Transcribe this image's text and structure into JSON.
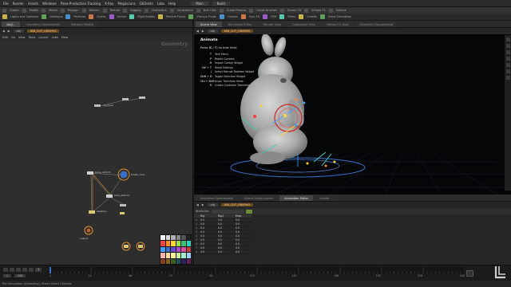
{
  "menubar": {
    "items": [
      "File",
      "Render",
      "Assets",
      "Windows",
      "Pane Production Tracking",
      "X-Ray",
      "Megascans",
      "GEOsets",
      "Labs",
      "Help"
    ],
    "title": "Main",
    "mode": "Build"
  },
  "shelf": {
    "tabs": [
      "Create",
      "Modify",
      "Model",
      "Polygon",
      "Deform",
      "Texture",
      "Rigging",
      "Characters",
      "Constraints",
      "Hair Utils",
      "Guide Process",
      "Guide Brushes",
      "Terrain FX",
      "Simple FX",
      "Volume"
    ]
  },
  "toolbar": {
    "items": [
      "Lights and Cameras",
      "Collisions",
      "Particles",
      "Grains",
      "Vellum",
      "Rigid Bodies",
      "Particle Fluids",
      "Viscous Fluids",
      "Oceans",
      "Pyro FX",
      "FEM",
      "Wires",
      "Crowds",
      "Drive Simulation"
    ]
  },
  "network": {
    "tabs": [
      "/obj/...",
      "Geometry Spreadsheet",
      "Material Palette"
    ],
    "path": "obj",
    "node_path": "KIN_CUT_GRAPHO",
    "menu": [
      "Edit",
      "Go",
      "View",
      "Tools",
      "Layout",
      "Labs",
      "Help"
    ],
    "context_label": "Geometry",
    "nodes": [
      "rig_pose",
      "bone_deform",
      "joint_deform",
      "kinefx_char",
      "skeleton",
      "output"
    ]
  },
  "viewport": {
    "tabs": [
      "Scene View",
      "Animation Editor",
      "Render View",
      "Composite View",
      "Motion FX View",
      "Geometry Spreadsheet"
    ],
    "path": "obj",
    "node_path": "KIN_CUT_GRAPHO",
    "state_title": "Animate",
    "hint": "Press ⌘ / F1 to hide hints",
    "keys": [
      {
        "k": "T",
        "label": "Task Menu"
      },
      {
        "k": "P",
        "label": "Rotate Controls"
      },
      {
        "k": "H",
        "label": "Import Control Widget"
      },
      {
        "k": "Ctrl + T",
        "label": "Reset Settings"
      },
      {
        "k": "J",
        "label": "Select Manual Skeleton Widget"
      },
      {
        "k": "Shift + D",
        "label": "Toggle Selection Widget"
      },
      {
        "k": "Ctrl + Shift",
        "label": "Unpin Transform Mode"
      },
      {
        "k": "R",
        "label": "Create Controller Transform"
      }
    ]
  },
  "spreadsheet": {
    "tabs": [
      "Keyframe Spreadsheet",
      "Scene Graph Layers",
      "Animation Editor",
      "Ladder"
    ],
    "path": "obj",
    "node_path": "KIN_CUT_GRAPHO",
    "columns": [
      "",
      "Rig",
      "Rig2",
      "Pose"
    ],
    "rows": [
      [
        "0",
        "0.0",
        "0.0",
        "0.0"
      ],
      [
        "1",
        "0.0",
        "0.0",
        "0.0"
      ],
      [
        "2",
        "0.0",
        "0.0",
        "0.0"
      ],
      [
        "3",
        "0.0",
        "0.0",
        "0.0"
      ],
      [
        "4",
        "0.0",
        "0.0",
        "0.0"
      ],
      [
        "5",
        "0.0",
        "0.0",
        "0.0"
      ],
      [
        "6",
        "0.0",
        "0.0",
        "0.0"
      ],
      [
        "7",
        "0.0",
        "0.0",
        "0.0"
      ],
      [
        "8",
        "0.0",
        "0.0",
        "0.0"
      ]
    ],
    "filter_label": "Attributes"
  },
  "timeline": {
    "frame": "1",
    "start": "1",
    "end": "240",
    "fps": "24",
    "ticks": [
      "1",
      "24",
      "48",
      "72",
      "96",
      "120",
      "144",
      "168",
      "192",
      "216",
      "240"
    ]
  },
  "status": {
    "text": "Pre-Simulation (Geometry), Sheer Select Controls"
  },
  "colors": {
    "viewport_bg": "#050607",
    "accent_orange": "#e0912b",
    "selection_blue": "#3b6ec8",
    "node_yellow": "#e8c84a"
  }
}
